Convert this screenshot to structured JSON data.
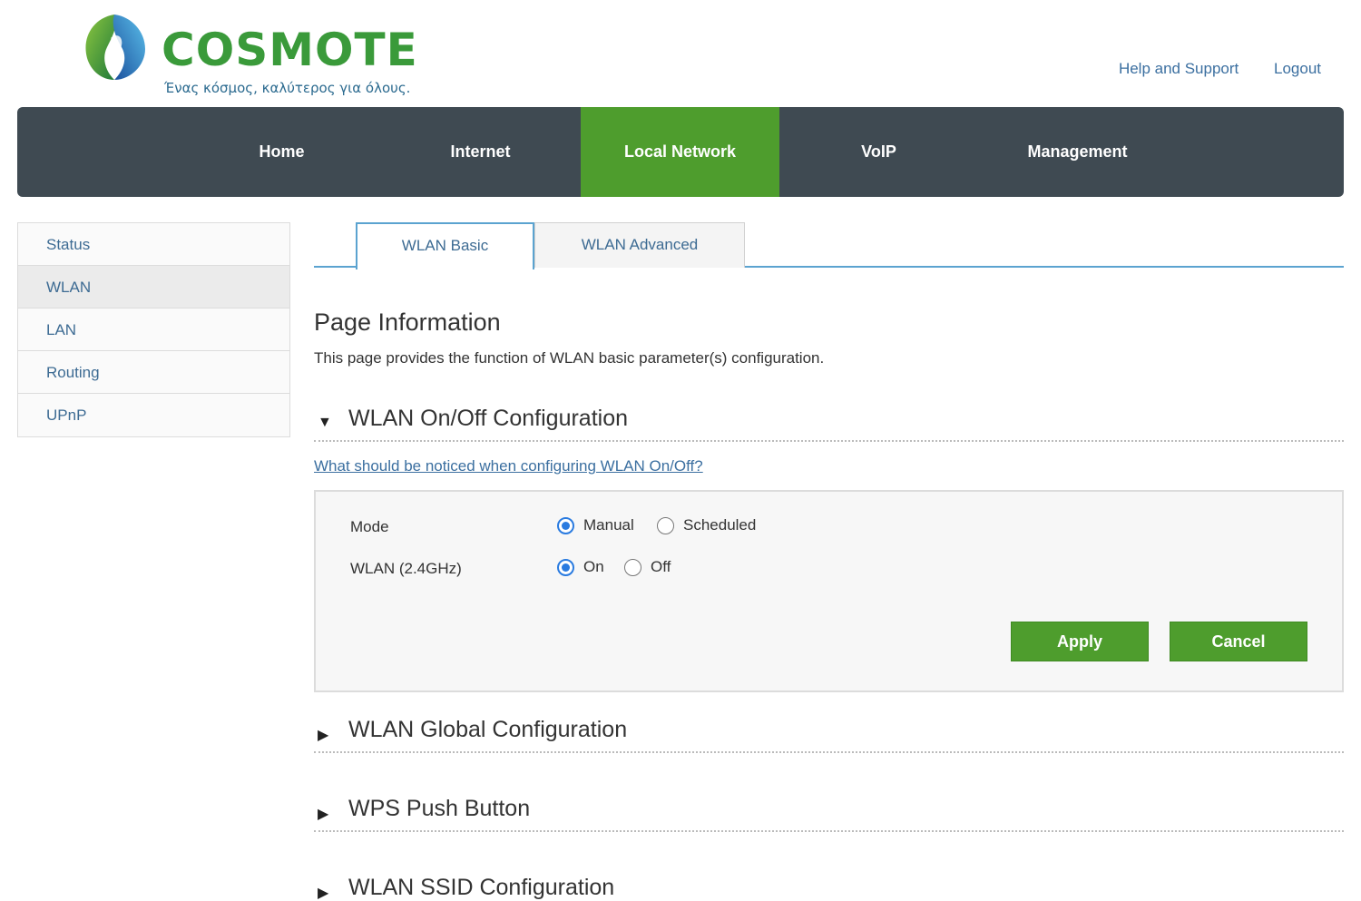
{
  "brand": {
    "name": "COSMOTE",
    "tagline": "Ένας κόσμος, καλύτερος για όλους.",
    "colors": {
      "green": "#4e9d2d",
      "nav_dark": "#3f4a52",
      "tab_blue": "#5ba3d0"
    }
  },
  "header": {
    "help_label": "Help and Support",
    "logout_label": "Logout"
  },
  "nav": [
    {
      "label": "Home"
    },
    {
      "label": "Internet"
    },
    {
      "label": "Local Network",
      "active": true
    },
    {
      "label": "VoIP"
    },
    {
      "label": "Management"
    }
  ],
  "sidebar": {
    "items": [
      {
        "label": "Status"
      },
      {
        "label": "WLAN",
        "active": true
      },
      {
        "label": "LAN"
      },
      {
        "label": "Routing"
      },
      {
        "label": "UPnP"
      }
    ]
  },
  "tabs": [
    {
      "label": "WLAN Basic",
      "active": true
    },
    {
      "label": "WLAN Advanced"
    }
  ],
  "page": {
    "title": "Page Information",
    "description": "This page provides the function of WLAN basic parameter(s) configuration."
  },
  "sections": {
    "onoff": {
      "title": "WLAN On/Off Configuration",
      "expanded": true,
      "arrow": "▼"
    },
    "global": {
      "title": "WLAN Global Configuration",
      "expanded": false,
      "arrow": "▶"
    },
    "wps": {
      "title": "WPS Push Button",
      "expanded": false,
      "arrow": "▶"
    },
    "ssid": {
      "title": "WLAN SSID Configuration",
      "expanded": false,
      "arrow": "▶"
    }
  },
  "help_link": "What should be noticed when configuring WLAN On/Off?",
  "form": {
    "mode": {
      "label": "Mode",
      "options": [
        "Manual",
        "Scheduled"
      ],
      "selected": "Manual"
    },
    "wlan24": {
      "label": "WLAN (2.4GHz)",
      "options": [
        "On",
        "Off"
      ],
      "selected": "On"
    },
    "apply_label": "Apply",
    "cancel_label": "Cancel"
  }
}
